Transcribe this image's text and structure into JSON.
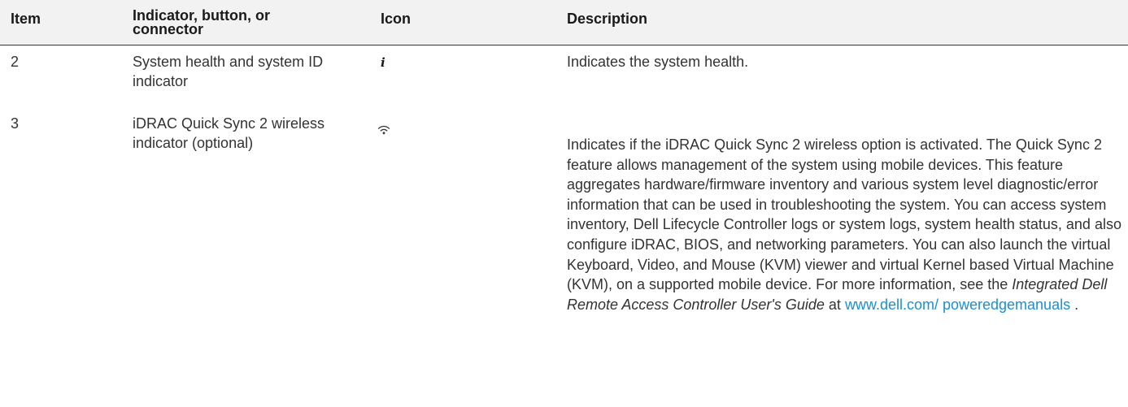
{
  "table": {
    "headers": {
      "item": "Item",
      "indicator": "Indicator, button, or connector",
      "icon": "Icon",
      "description": "Description"
    },
    "rows": [
      {
        "item": "2",
        "indicator": "System health and system ID indicator",
        "icon": "info-icon",
        "description": "Indicates the system health."
      },
      {
        "item": "3",
        "indicator": "iDRAC Quick Sync 2 wireless indicator (optional)",
        "icon": "wireless-icon",
        "description_part1": "Indicates if the iDRAC Quick Sync 2 wireless option is activated. The Quick Sync 2 feature allows management of the system using mobile devices. This feature aggregates hardware/firmware inventory and various system level diagnostic/error information that can be used in troubleshooting the system. You can access system inventory, Dell Lifecycle Controller logs or system logs, system health status, and also configure iDRAC, BIOS, and networking parameters. You can also launch the virtual Keyboard, Video, and Mouse (KVM) viewer and virtual Kernel based Virtual Machine (KVM), on a supported mobile device. For more information, see the",
        "description_guide": "Integrated Dell Remote Access Controller User's Guide",
        "description_at": "at",
        "description_link": "www.dell.com/ poweredgemanuals",
        "description_end": "."
      }
    ]
  },
  "colors": {
    "header_bg": "#f2f2f2",
    "text": "#333333",
    "link": "#1a8fd6"
  }
}
